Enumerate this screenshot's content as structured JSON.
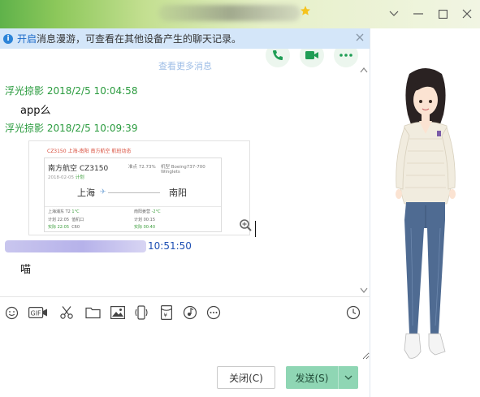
{
  "window": {
    "controls": [
      "chevron-down-icon",
      "minimize-icon",
      "maximize-icon",
      "close-icon"
    ]
  },
  "notice": {
    "link": "开启",
    "text": "消息漫游，可查看在其他设备产生的聊天记录。"
  },
  "chat": {
    "actions": [
      "phone-icon",
      "video-icon",
      "more-icon"
    ],
    "more_history": "查看更多消息",
    "messages": [
      {
        "sender": "浮光掠影",
        "time": "2018/2/5 10:04:58",
        "text": "app么"
      },
      {
        "sender": "浮光掠影",
        "time": "2018/2/5 10:09:39",
        "text": ""
      },
      {
        "sender": "",
        "time": "10:51:50",
        "text": "喵"
      }
    ],
    "flight_card": {
      "header": "CZ3150 上海-南阳 南方航空 航班动态",
      "airline": "南方航空 CZ3150",
      "date": "2018-02-05",
      "status": "计划",
      "punctuality": "准点 72.73%",
      "aircraft": "机型 Boeing737-700 Winglets",
      "origin": "上海",
      "destination": "南阳",
      "origin_airport": "上海浦东 T2",
      "origin_temp": "1°C",
      "destination_airport": "南阳姜营",
      "destination_temp": "-2°C",
      "dep_plan": "计划 22:05",
      "dep_actual": "实际 22:05",
      "checkin": "值机口",
      "checkin_no": "C60",
      "arr_plan": "计划 00:15",
      "arr_actual": "实际 00:40"
    }
  },
  "toolbar": [
    "emoji-icon",
    "gif-icon",
    "scissors-icon",
    "folder-icon",
    "image-icon",
    "shake-icon",
    "red-packet-icon",
    "music-icon",
    "more-icon",
    "history-clock-icon"
  ],
  "buttons": {
    "close": "关闭(C)",
    "send": "发送(S)"
  }
}
